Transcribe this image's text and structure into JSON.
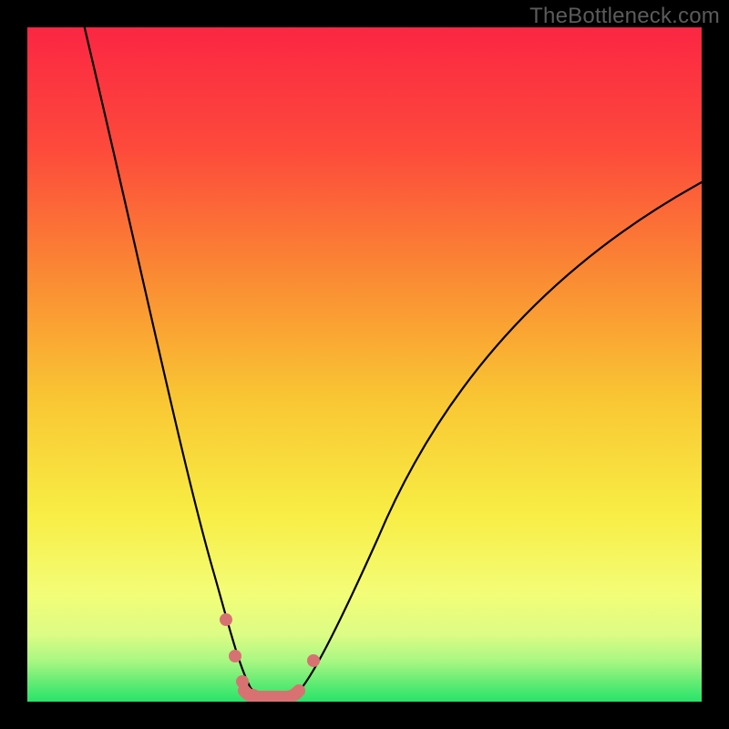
{
  "watermark": "TheBottleneck.com",
  "colors": {
    "gradient_top": "#fb2643",
    "gradient_mid": "#f9d031",
    "gradient_low": "#f7fe6f",
    "gradient_bottom": "#27e46a",
    "curve": "#000000",
    "flat_zone": "#d87272",
    "background": "#000000"
  },
  "chart_data": {
    "type": "line",
    "title": "",
    "xlabel": "",
    "ylabel": "",
    "xlim": [
      0,
      1
    ],
    "ylim": [
      0,
      100
    ],
    "series": [
      {
        "name": "bottleneck-curve",
        "x": [
          0.0,
          0.05,
          0.1,
          0.15,
          0.2,
          0.23,
          0.26,
          0.28,
          0.3,
          0.315,
          0.33,
          0.35,
          0.37,
          0.39,
          0.41,
          0.45,
          0.5,
          0.55,
          0.6,
          0.65,
          0.7,
          0.75,
          0.8,
          0.85,
          0.9,
          0.95,
          1.0
        ],
        "values": [
          120,
          100,
          80,
          60,
          40,
          28,
          18,
          10,
          4,
          1,
          0,
          0,
          0,
          1,
          4,
          12,
          22,
          31,
          39,
          46,
          52,
          58,
          63,
          67,
          71,
          74,
          77
        ]
      }
    ],
    "flat_zone": {
      "x_start": 0.315,
      "x_end": 0.38,
      "value": 0
    },
    "markers": [
      {
        "x": 0.28,
        "value": 10
      },
      {
        "x": 0.295,
        "value": 5
      },
      {
        "x": 0.305,
        "value": 2
      },
      {
        "x": 0.315,
        "value": 0
      },
      {
        "x": 0.38,
        "value": 0
      },
      {
        "x": 0.405,
        "value": 5
      }
    ]
  }
}
